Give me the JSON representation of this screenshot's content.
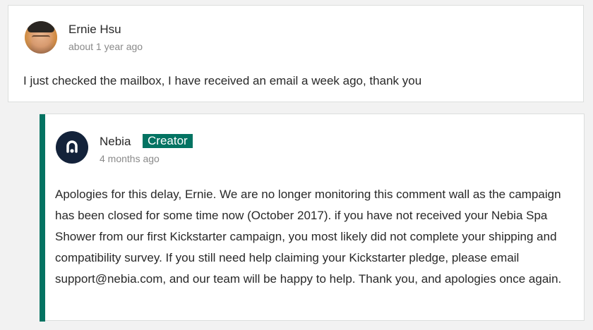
{
  "comment": {
    "author": "Ernie Hsu",
    "time": "about 1 year ago",
    "text": "I just checked the mailbox, I have received an email a week ago, thank you",
    "avatar_icon": "user-photo"
  },
  "reply": {
    "author": "Nebia",
    "badge": "Creator",
    "time": "4 months ago",
    "text": "Apologies for this delay, Ernie. We are no longer monitoring this comment wall as the campaign has been closed for some time now (October 2017). if you have not received your Nebia Spa Shower from our first Kickstarter campaign, you most likely did not complete your shipping and compatibility survey. If you still need help claiming your Kickstarter pledge, please email support@nebia.com, and our team will be happy to help. Thank you, and apologies once again.",
    "avatar_icon": "nebia-logo",
    "accent_color": "#037362"
  }
}
